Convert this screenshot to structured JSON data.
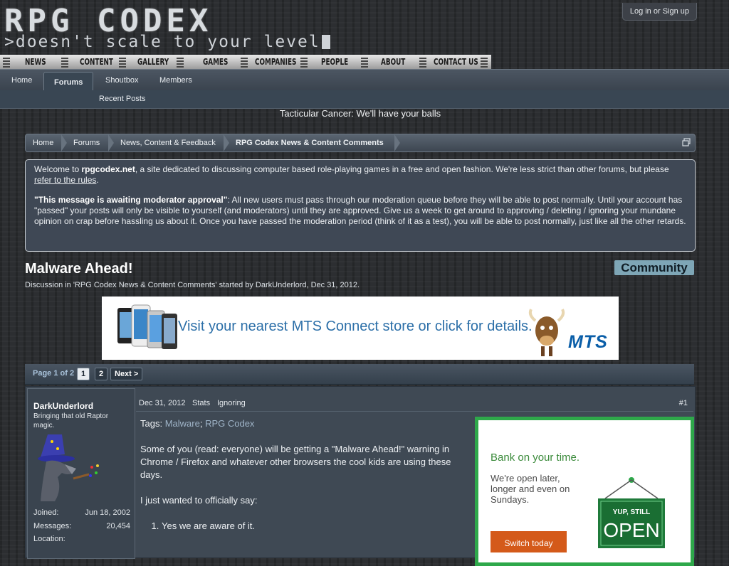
{
  "header": {
    "logo_title": "RPG CODEX",
    "logo_tagline": ">doesn't scale to your level",
    "login_label": "Log in or Sign up"
  },
  "topnav": {
    "items": [
      "NEWS",
      "CONTENT",
      "GALLERY",
      "GAMES",
      "COMPANIES",
      "PEOPLE",
      "ABOUT",
      "CONTACT US"
    ]
  },
  "forumnav": {
    "tabs": [
      "Home",
      "Forums",
      "Shoutbox",
      "Members"
    ],
    "active": "Forums",
    "sub_link": "Recent Posts"
  },
  "slogan": "Tacticular Cancer: We'll have your balls",
  "breadcrumb": [
    "Home",
    "Forums",
    "News, Content & Feedback",
    "RPG Codex News & Content Comments"
  ],
  "notice": {
    "p1_start": "Welcome to ",
    "p1_site": "rpgcodex.net",
    "p1_mid": ", a site dedicated to discussing computer based role-playing games in a free and open fashion. We're less strict than other forums, but please ",
    "p1_link": "refer to the rules",
    "p1_end": ".",
    "p2_bold": "\"This message is awaiting moderator approval\"",
    "p2_text": ": All new users must pass through our moderation queue before they will be able to post normally. Until your account has \"passed\" your posts will only be visible to yourself (and moderators) until they are approved. Give us a week to get around to approving / deleting / ignoring your mundane opinion on crap before hassling us about it. Once you have passed the moderation period (think of it as a test), you will be able to post normally, just like all the other retards."
  },
  "thread": {
    "title": "Malware Ahead!",
    "meta": "Discussion in 'RPG Codex News & Content Comments' started by DarkUnderlord, Dec 31, 2012.",
    "prefix": "Community"
  },
  "ad": {
    "text": "Visit your nearest MTS Connect store or click for details.",
    "logo": "MTS"
  },
  "pagenav": {
    "label": "Page 1 of 2",
    "pages": [
      "1",
      "2"
    ],
    "current": "1",
    "next": "Next >"
  },
  "post": {
    "username": "DarkUnderlord",
    "user_title": "Bringing that old Raptor magic.",
    "stats": [
      {
        "label": "Joined:",
        "value": "Jun 18, 2002"
      },
      {
        "label": "Messages:",
        "value": "20,454"
      },
      {
        "label": "Location:",
        "value": ""
      }
    ],
    "date": "Dec 31, 2012",
    "stats_link": "Stats",
    "ignoring_link": "Ignoring",
    "number": "#1",
    "tags_label": "Tags:",
    "tags": [
      "Malware",
      "RPG Codex"
    ],
    "para1": "Some of you (read: everyone) will be getting a \"Malware Ahead!\" warning in Chrome / Firefox and whatever other browsers the cool kids are using these days.",
    "para2": "I just wanted to officially say:",
    "list1": "Yes we are aware of it."
  },
  "bank_ad": {
    "headline": "Bank on your time.",
    "body": "We're open later, longer and even on Sundays.",
    "sign_top": "YUP, STILL",
    "sign_main": "OPEN",
    "button": "Switch today"
  },
  "colors": {
    "page_bg": "#2c2e31",
    "bar_bg": "#394653",
    "prefix_bg": "#7ea6b6",
    "bank_green": "#2ea84a",
    "ad_blue": "#2c6fa8"
  }
}
